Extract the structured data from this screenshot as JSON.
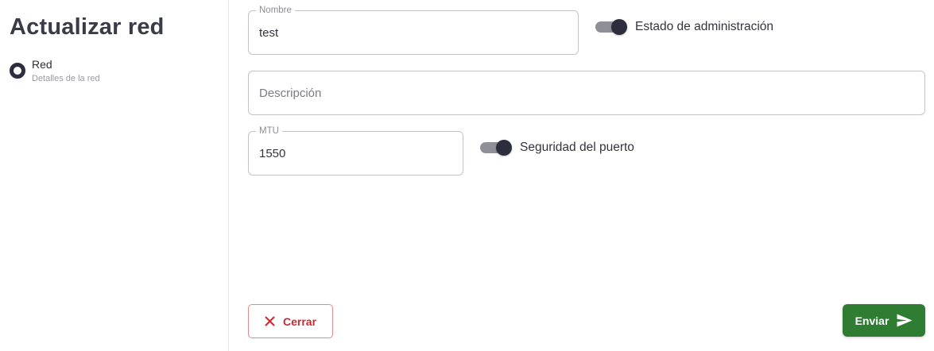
{
  "sidebar": {
    "title": "Actualizar red",
    "steps": [
      {
        "label": "Red",
        "sublabel": "Detalles de la red"
      }
    ]
  },
  "form": {
    "name": {
      "legend": "Nombre",
      "value": "test"
    },
    "admin_state": {
      "label": "Estado de administración",
      "checked": true
    },
    "description": {
      "placeholder": "Descripción",
      "value": ""
    },
    "mtu": {
      "legend": "MTU",
      "value": "1550"
    },
    "port_security": {
      "label": "Seguridad del puerto",
      "checked": true
    }
  },
  "actions": {
    "close_label": "Cerrar",
    "close_icon": "close-icon",
    "submit_label": "Enviar",
    "submit_icon": "send-icon"
  },
  "colors": {
    "primary_dark": "#2d2e3d",
    "danger": "#c62a32",
    "success": "#2e7d32"
  }
}
